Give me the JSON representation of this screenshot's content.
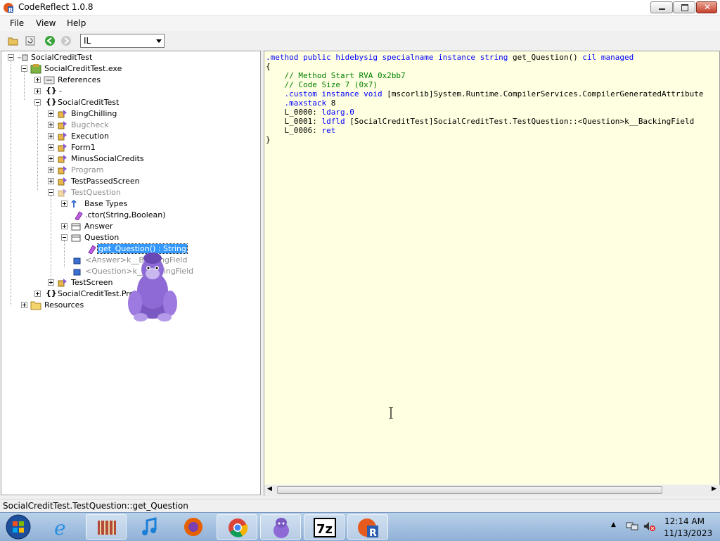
{
  "window": {
    "title": "CodeReflect 1.0.8"
  },
  "menu": [
    "File",
    "View",
    "Help"
  ],
  "toolbar": {
    "language": "IL"
  },
  "tree": {
    "root": "SocialCreditTest",
    "exe": "SocialCreditTest.exe",
    "references": "References",
    "ns_empty": "-",
    "ns_main": "SocialCreditTest",
    "types": [
      "BingChilling",
      "Bugcheck",
      "Execution",
      "Form1",
      "MinusSocialCredits",
      "Program",
      "TestPassedScreen",
      "TestQuestion"
    ],
    "tq_children": {
      "base_types": "Base Types",
      "ctor": ".ctor(String,Boolean)",
      "answer": "Answer",
      "question": "Question",
      "getter": "get_Question() : String",
      "answer_field": "<Answer>k__BackingField",
      "question_field": "<Question>k__BackingField"
    },
    "test_screen": "TestScreen",
    "properties": "SocialCreditTest.Properties",
    "resources": "Resources"
  },
  "code": [
    ".method public hidebysig specialname instance string get_Question() cil managed",
    "{",
    "    // Method Start RVA 0x2bb7",
    "    // Code Size 7 (0x7)",
    "    .custom instance void [mscorlib]System.Runtime.CompilerServices.CompilerGeneratedAttribute",
    "    .maxstack 8",
    "    L_0000: ldarg.0",
    "    L_0001: ldfld [SocialCreditTest]SocialCreditTest.TestQuestion::<Question>k__BackingField",
    "    L_0006: ret",
    "}"
  ],
  "status": "SocialCreditTest.TestQuestion::get_Question",
  "taskbar": {
    "time": "12:14 AM",
    "date": "11/13/2023",
    "apps": [
      "internet-explorer",
      "library-manager",
      "itunes",
      "firefox",
      "chrome",
      "bonzibuddy",
      "7-zip",
      "codereflect"
    ]
  },
  "colors": {
    "code_bg": "#ffffe1",
    "selection": "#3399ff",
    "keyword": "#0000ff",
    "comment": "#008000"
  }
}
